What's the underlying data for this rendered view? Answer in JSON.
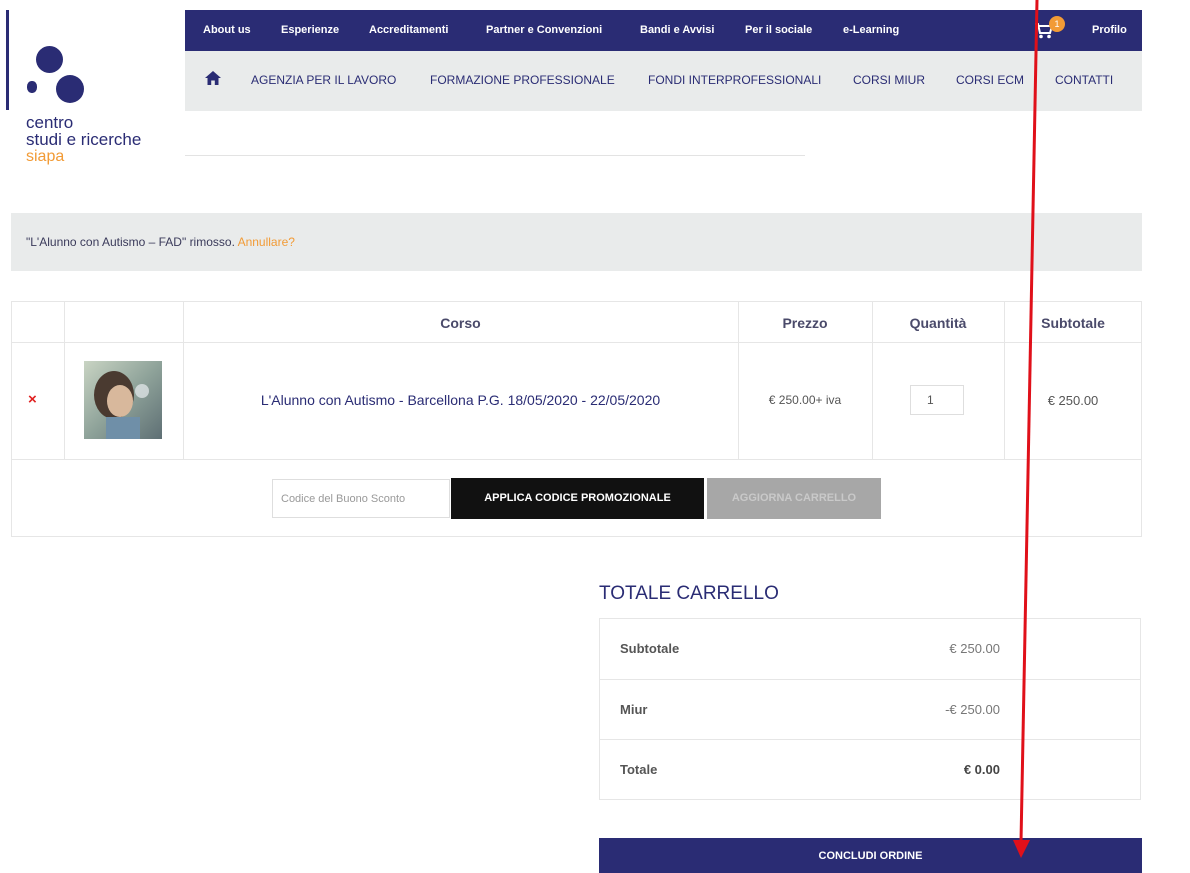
{
  "logo": {
    "line1": "centro",
    "line2": "studi e ricerche",
    "line3": "siapa"
  },
  "top_nav": {
    "items": [
      "About us",
      "Esperienze",
      "Accreditamenti",
      "Partner e Convenzioni",
      "Bandi e Avvisi",
      "Per il sociale",
      "e-Learning"
    ],
    "cart_count": "1",
    "profile": "Profilo"
  },
  "sub_nav": {
    "home_icon": "home-icon",
    "items": [
      "AGENZIA PER IL LAVORO",
      "FORMAZIONE PROFESSIONALE",
      "FONDI INTERPROFESSIONALI",
      "CORSI MIUR",
      "CORSI ECM",
      "CONTATTI"
    ]
  },
  "notice": {
    "text": "\"L'Alunno con Autismo – FAD\" rimosso.",
    "undo": "Annullare?"
  },
  "cart_table": {
    "headers": {
      "course": "Corso",
      "price": "Prezzo",
      "quantity": "Quantità",
      "subtotal": "Subtotale"
    },
    "rows": [
      {
        "remove": "×",
        "name": "L'Alunno con Autismo - Barcellona P.G. 18/05/2020 - 22/05/2020",
        "price": "€ 250.00+ iva",
        "quantity": "1",
        "subtotal": "€ 250.00"
      }
    ],
    "coupon_placeholder": "Codice del Buono Sconto",
    "apply_label": "APPLICA CODICE PROMOZIONALE",
    "update_label": "AGGIORNA CARRELLO"
  },
  "totals": {
    "title": "TOTALE CARRELLO",
    "subtotal_label": "Subtotale",
    "subtotal_value": "€ 250.00",
    "discount_label": "Miur",
    "discount_value": "-€ 250.00",
    "total_label": "Totale",
    "total_value": "€ 0.00"
  },
  "checkout_label": "CONCLUDI ORDINE",
  "colors": {
    "brand": "#2a2c74",
    "accent": "#f29b36",
    "annotation": "#e0101a"
  }
}
